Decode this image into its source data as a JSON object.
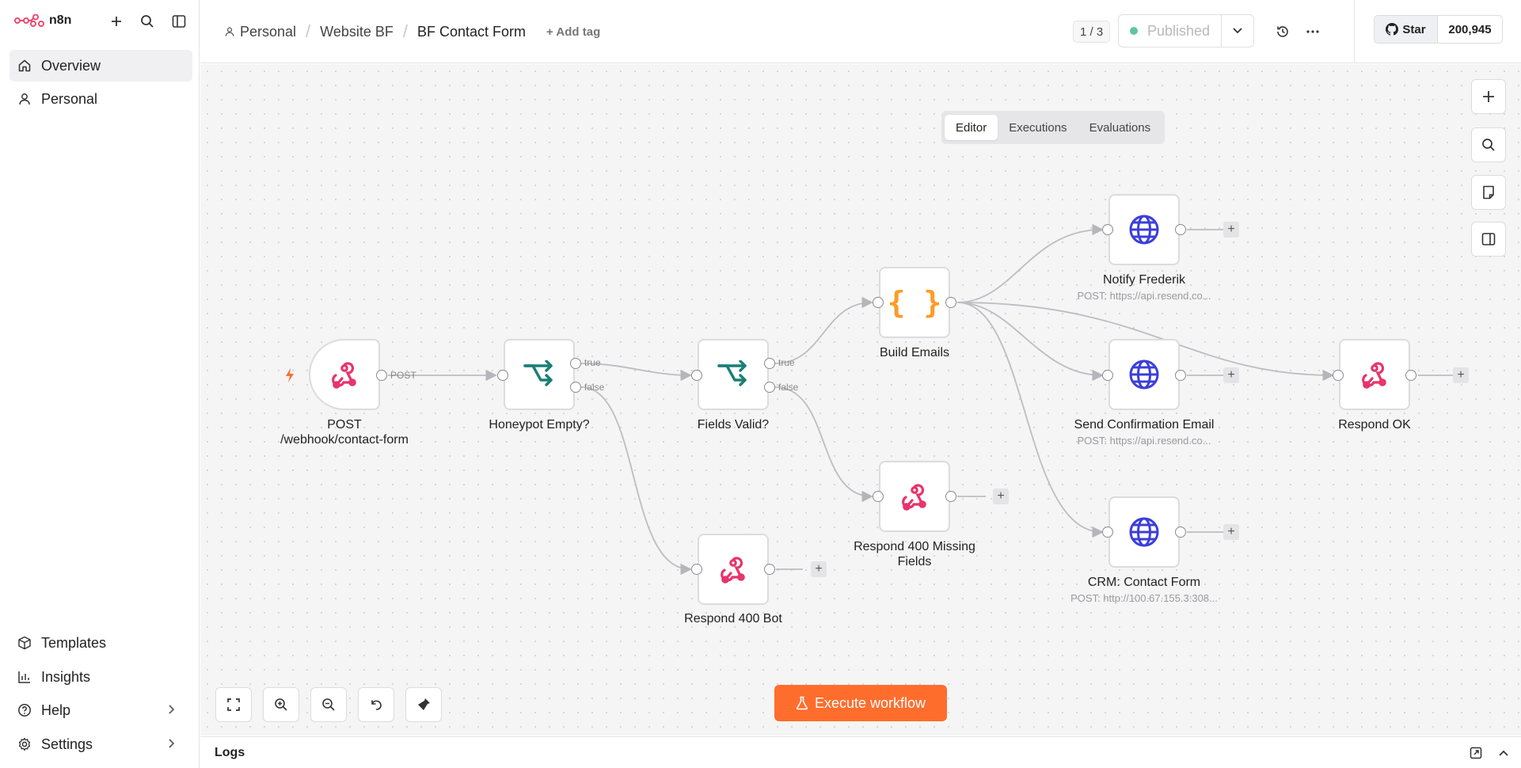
{
  "app": {
    "name": "n8n",
    "accent": "#ff6d2d"
  },
  "sidebar": {
    "top_items": [
      {
        "label": "Overview",
        "icon": "home-icon",
        "active": true
      },
      {
        "label": "Personal",
        "icon": "user-icon",
        "active": false
      }
    ],
    "bottom_items": [
      {
        "label": "Templates",
        "icon": "box-icon"
      },
      {
        "label": "Insights",
        "icon": "chart-icon"
      },
      {
        "label": "Help",
        "icon": "help-icon"
      },
      {
        "label": "Settings",
        "icon": "gear-icon"
      }
    ]
  },
  "header": {
    "breadcrumb": [
      "Personal",
      "Website BF",
      "BF Contact Form"
    ],
    "add_tag": "+ Add tag",
    "version_pager": "1 / 3",
    "publish_status": "Published",
    "github": {
      "star_label": "Star",
      "count": "200,945"
    }
  },
  "canvas_tabs": [
    {
      "label": "Editor",
      "active": true
    },
    {
      "label": "Executions",
      "active": false
    },
    {
      "label": "Evaluations",
      "active": false
    }
  ],
  "nodes": {
    "webhook": {
      "label_line1": "POST",
      "label_line2": "/webhook/contact-form",
      "output_label": "POST"
    },
    "honeypot": {
      "label": "Honeypot Empty?",
      "true_label": "true",
      "false_label": "false"
    },
    "fields_valid": {
      "label": "Fields Valid?",
      "true_label": "true",
      "false_label": "false"
    },
    "build_emails": {
      "label": "Build Emails"
    },
    "notify": {
      "label": "Notify Frederik",
      "sub": "POST: https://api.resend.co..."
    },
    "send_confirmation": {
      "label": "Send Confirmation Email",
      "sub": "POST: https://api.resend.co..."
    },
    "crm": {
      "label": "CRM: Contact Form",
      "sub": "POST: http://100.67.155.3:308..."
    },
    "respond_ok": {
      "label": "Respond OK"
    },
    "respond_missing": {
      "label_line1": "Respond 400 Missing",
      "label_line2": "Fields"
    },
    "respond_bot": {
      "label": "Respond 400 Bot"
    }
  },
  "execute_button": "Execute workflow",
  "logs": {
    "title": "Logs"
  },
  "colors": {
    "webhook": "#e8336b",
    "if_node": "#1a7f75",
    "code_node": "#ff9b26",
    "http_node": "#3b3fd8",
    "published_dot": "#5fc6a4"
  }
}
